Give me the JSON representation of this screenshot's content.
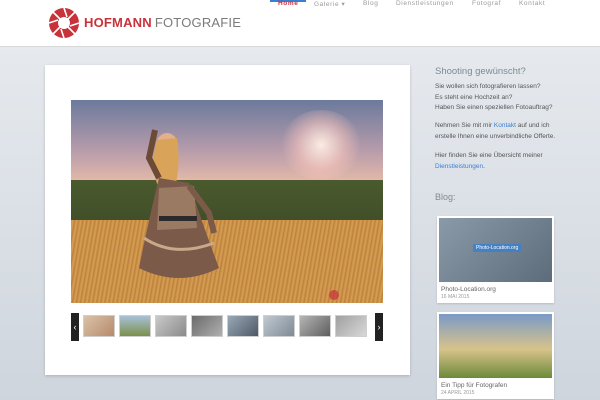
{
  "brand": {
    "name_bold": "HOFMANN",
    "name_light": "FOTOGRAFIE"
  },
  "nav": [
    {
      "label": "Home",
      "active": true
    },
    {
      "label": "Galerie ▾",
      "active": false
    },
    {
      "label": "Blog",
      "active": false
    },
    {
      "label": "Dienstleistungen",
      "active": false
    },
    {
      "label": "Fotograf",
      "active": false
    },
    {
      "label": "Kontakt",
      "active": false
    }
  ],
  "sidebar": {
    "title": "Shooting gewünscht?",
    "line1": "Sie wollen sich fotografieren lassen?",
    "line2": "Es steht eine Hochzeit an?",
    "line3": "Haben Sie einen speziellen Fotoauftrag?",
    "p2_pre": "Nehmen Sie mit mir ",
    "p2_link": "Kontakt",
    "p2_post": " auf und ich",
    "p2_line2": "erstelle Ihnen eine unverbindliche Offerte.",
    "p3_line1": "Hier finden Sie eine Übersicht meiner",
    "p3_link": "Dienstleistungen",
    "p3_post": ".",
    "blog_title": "Blog:"
  },
  "blog": [
    {
      "title": "Photo-Location.org",
      "date": "16 MAI 2015",
      "overlay": "Photo-Location.org"
    },
    {
      "title": "Ein Tipp für Fotografen",
      "date": "24 APRIL 2015"
    }
  ],
  "gallery": {
    "thumb_count": 8
  },
  "colors": {
    "accent_red": "#c8323a",
    "link_blue": "#3a7fd0"
  }
}
